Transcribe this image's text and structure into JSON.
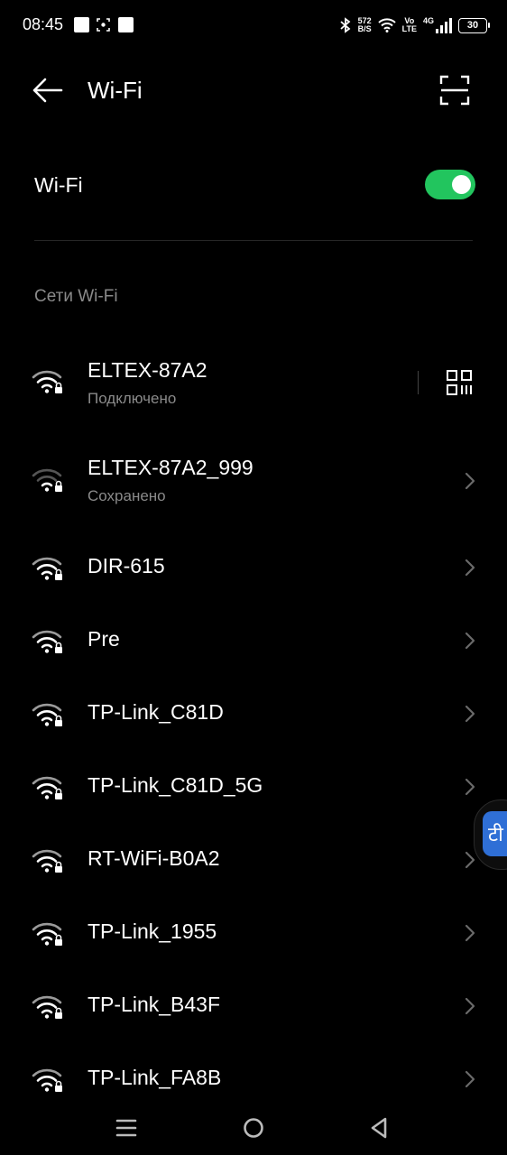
{
  "status_bar": {
    "time": "08:45",
    "speed_value": "572",
    "speed_unit": "B/S",
    "volte_top": "Vo",
    "volte_bottom": "LTE",
    "network": "4G",
    "battery": "30"
  },
  "header": {
    "title": "Wi-Fi",
    "back_icon": "arrow-left-icon",
    "scan_icon": "qr-scan-icon"
  },
  "wifi_toggle": {
    "label": "Wi-Fi",
    "state": "on",
    "color": "#22c55e"
  },
  "section": {
    "title": "Сети Wi-Fi"
  },
  "networks": [
    {
      "name": "ELTEX-87A2",
      "status": "Подключено"
    },
    {
      "name": "ELTEX-87A2_999",
      "status": "Сохранено"
    },
    {
      "name": "DIR-615",
      "status": ""
    },
    {
      "name": "Pre",
      "status": ""
    },
    {
      "name": "TP-Link_C81D",
      "status": ""
    },
    {
      "name": "TP-Link_C81D_5G",
      "status": ""
    },
    {
      "name": "RT-WiFi-B0A2",
      "status": ""
    },
    {
      "name": "TP-Link_1955",
      "status": ""
    },
    {
      "name": "TP-Link_B43F",
      "status": ""
    },
    {
      "name": "TP-Link_FA8B",
      "status": ""
    }
  ],
  "floating_bubble": {
    "glyph": "टी"
  },
  "nav_bar": {
    "icons": [
      "menu-icon",
      "home-icon",
      "back-icon"
    ]
  }
}
